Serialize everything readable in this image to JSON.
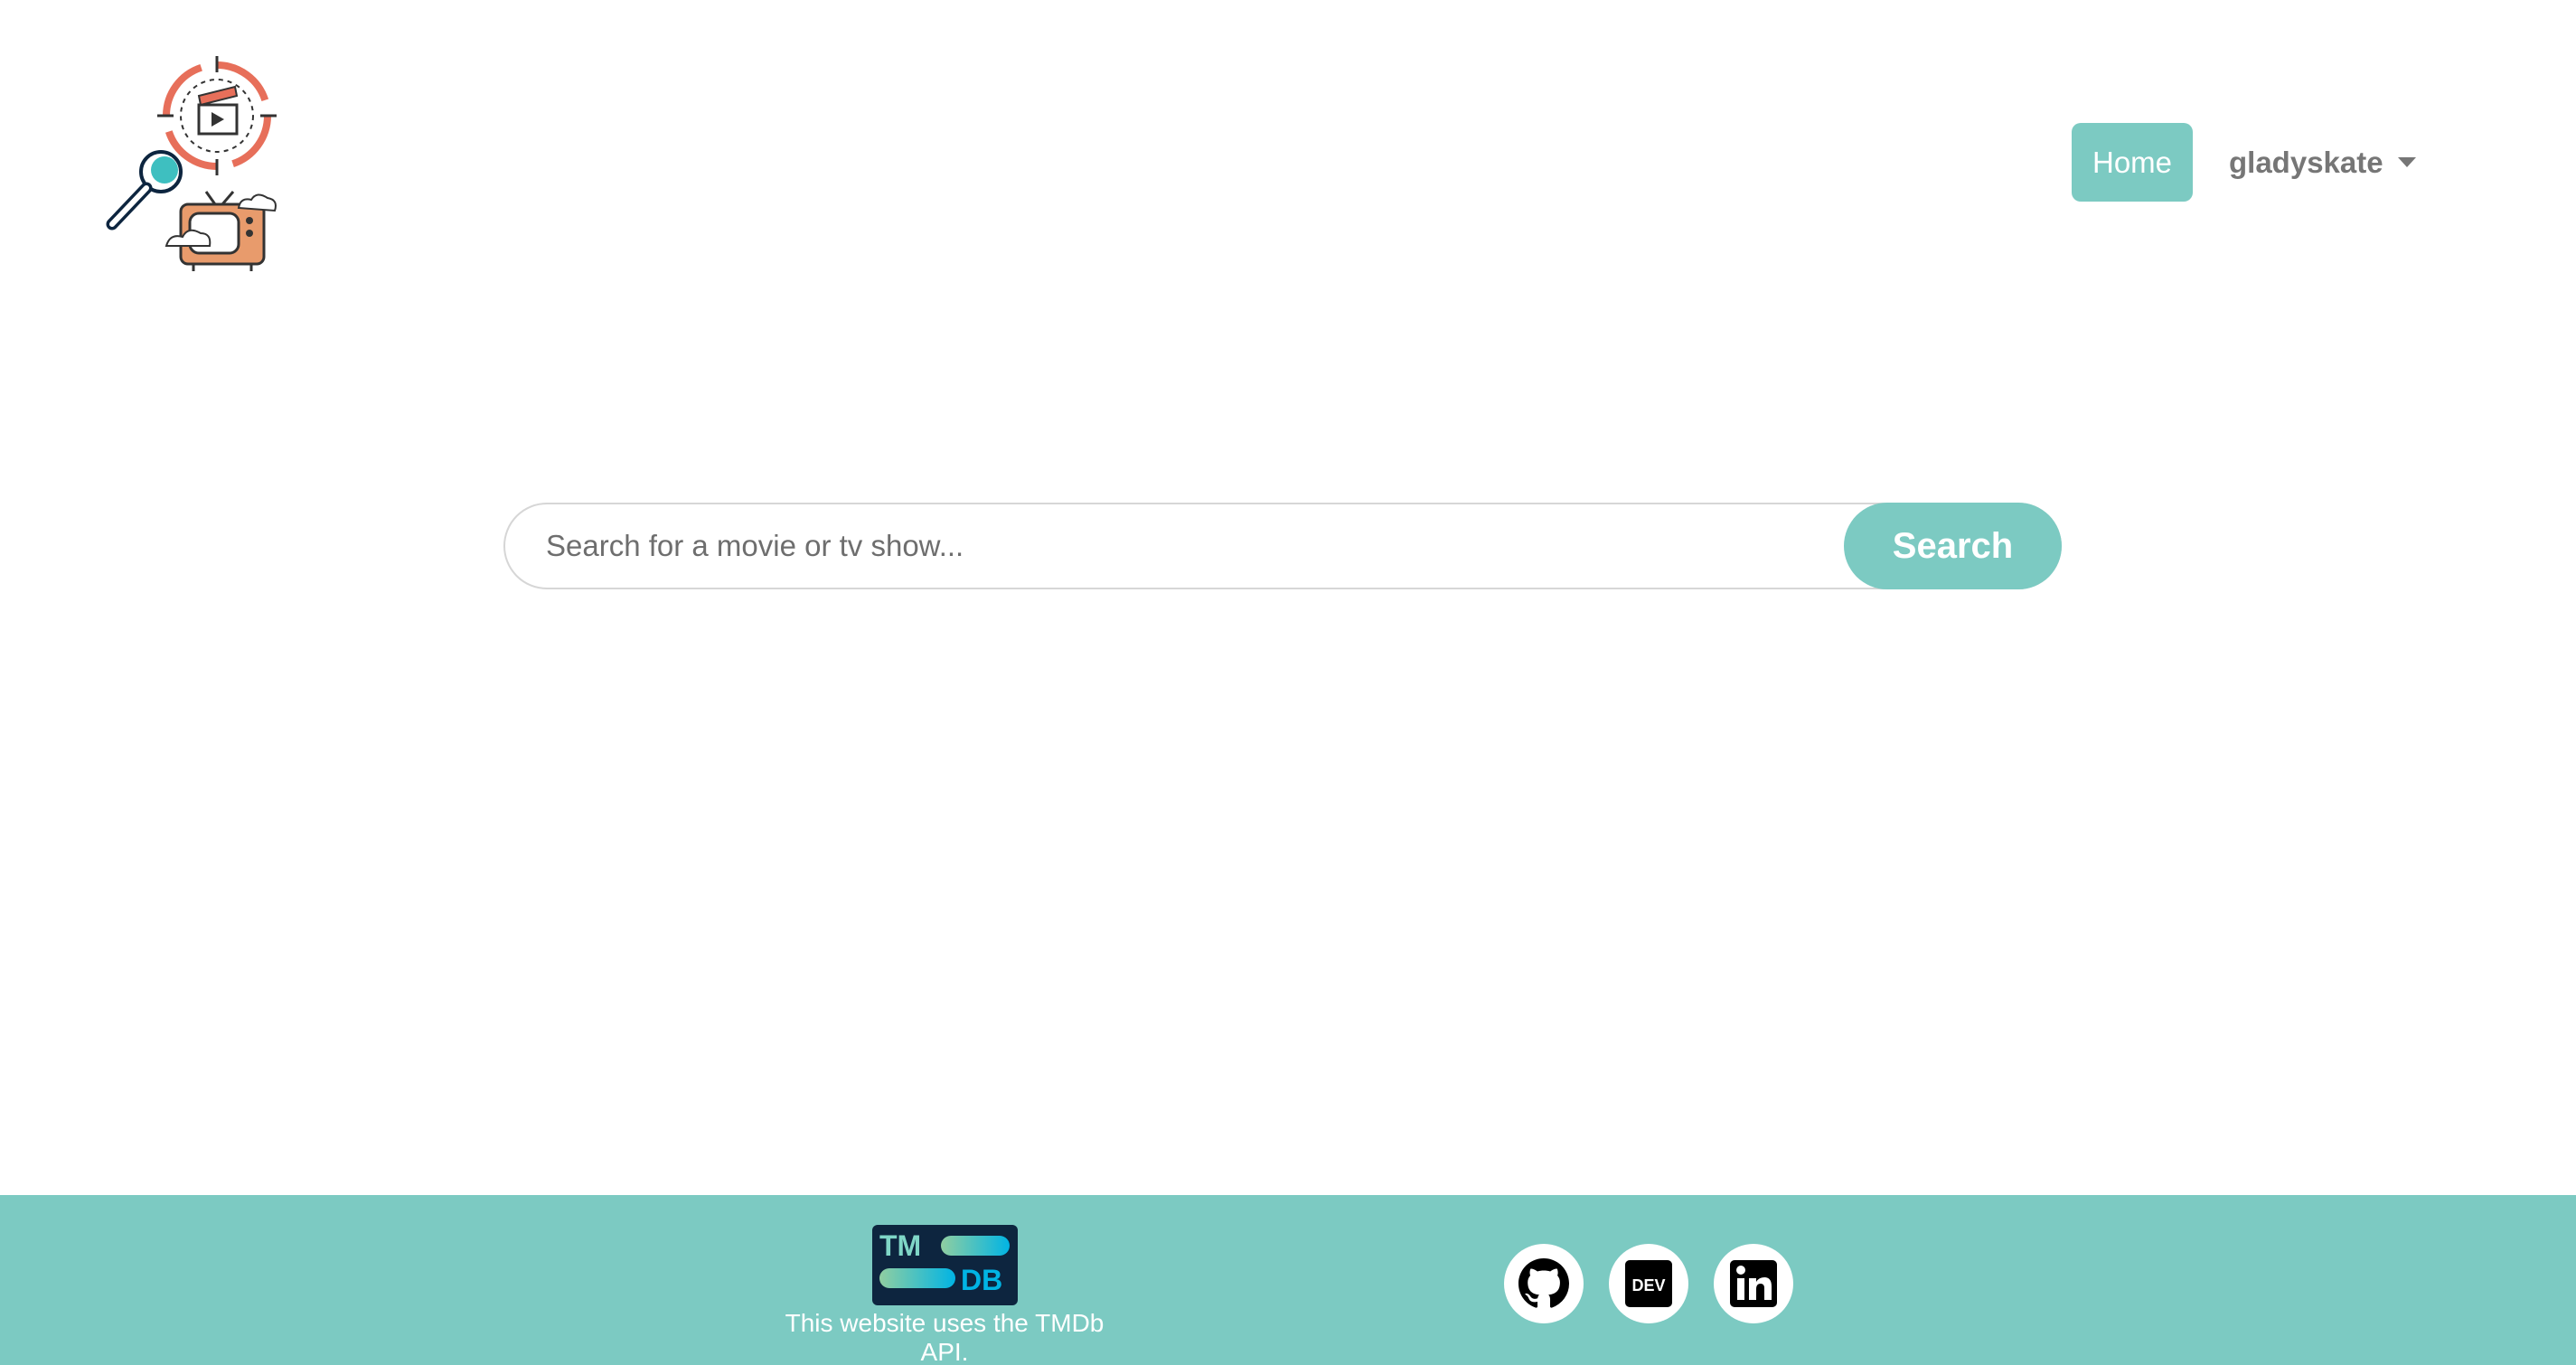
{
  "header": {
    "logo": "movie-tv-search-logo",
    "home_label": "Home",
    "username": "gladyskate"
  },
  "search": {
    "placeholder": "Search for a movie or tv show...",
    "value": "",
    "button_label": "Search"
  },
  "footer": {
    "tmdb_logo_text": "TMDB",
    "attribution": "This website uses the TMDb API.",
    "social_links": [
      {
        "icon": "github-icon",
        "label": "GitHub"
      },
      {
        "icon": "dev-icon",
        "label": "DEV"
      },
      {
        "icon": "linkedin-icon",
        "label": "LinkedIn"
      }
    ]
  },
  "colors": {
    "accent": "#7ccac2",
    "tmdb_navy": "#0d253f",
    "tmdb_blue": "#01b4e4",
    "tmdb_green": "#90cea1",
    "logo_red": "#e76f5a",
    "logo_teal": "#3ebfc0",
    "logo_tv_orange": "#e89b6c"
  }
}
